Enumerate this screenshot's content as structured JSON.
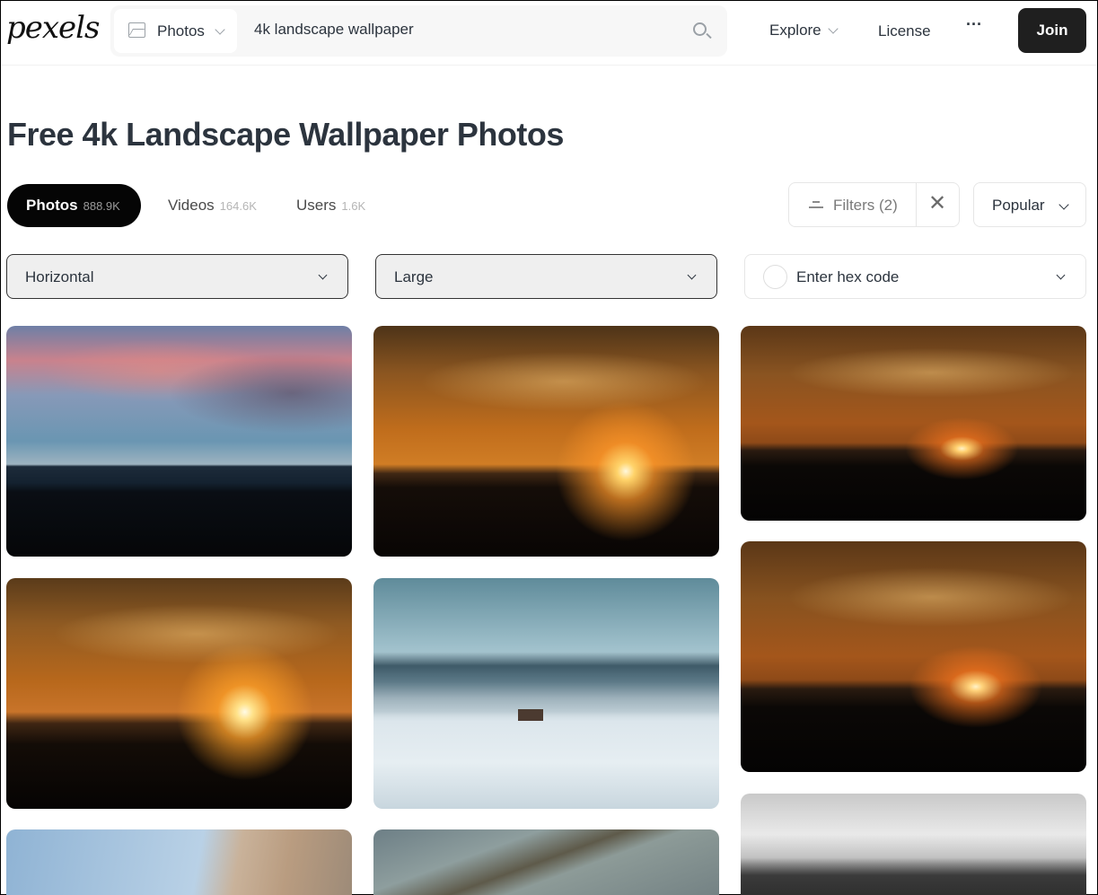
{
  "header": {
    "logo": "pexels",
    "search": {
      "type_label": "Photos",
      "query": "4k landscape wallpaper"
    },
    "nav": {
      "explore": "Explore",
      "license": "License",
      "more": "···",
      "join": "Join"
    }
  },
  "page_title": "Free 4k Landscape Wallpaper Photos",
  "tabs": [
    {
      "label": "Photos",
      "count": "888.9K",
      "active": true
    },
    {
      "label": "Videos",
      "count": "164.6K",
      "active": false
    },
    {
      "label": "Users",
      "count": "1.6K",
      "active": false
    }
  ],
  "filters": {
    "label": "Filters (2)",
    "clear_icon": "close-icon",
    "sort": "Popular"
  },
  "selects": {
    "orientation": "Horizontal",
    "size": "Large",
    "color_placeholder": "Enter hex code"
  },
  "photos": [
    {
      "subject": "pink clouds over blue mountain silhouette"
    },
    {
      "subject": "orange sunset over hills"
    },
    {
      "subject": "sun setting behind ridge"
    },
    {
      "subject": "golden sunset with clouds"
    },
    {
      "subject": "snowy valley with cabin and mountains"
    },
    {
      "subject": "sun setting behind ridge, orange sky"
    },
    {
      "subject": "rocky cliff under blue sky"
    },
    {
      "subject": "aerial river landscape"
    },
    {
      "subject": "black and white mountain peaks with clouds"
    }
  ],
  "colors": {
    "join_bg": "#1f1f1f",
    "active_tab_bg": "#050505",
    "text": "#2c343e"
  }
}
